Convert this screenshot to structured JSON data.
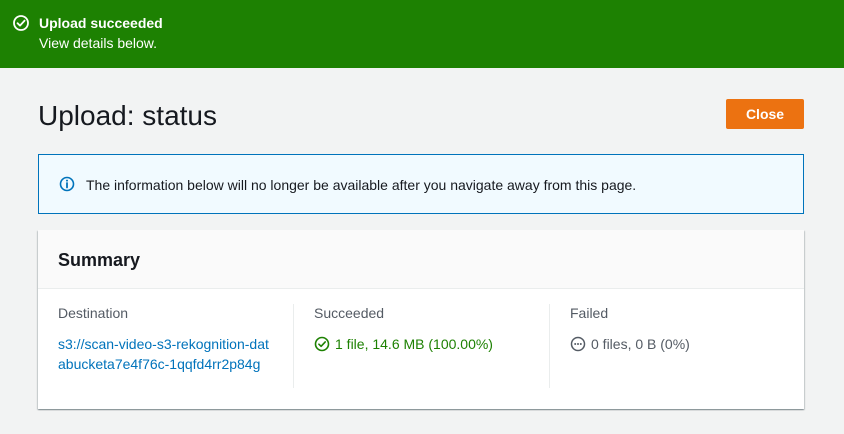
{
  "banner": {
    "title": "Upload succeeded",
    "subtitle": "View details below.",
    "icon": "check-circle-icon",
    "color": "#1d8102"
  },
  "page": {
    "title": "Upload: status",
    "close_label": "Close",
    "accent": "#ec7211"
  },
  "info": {
    "icon": "info-icon",
    "text": "The information below will no longer be available after you navigate away from this page."
  },
  "summary": {
    "heading": "Summary",
    "destination": {
      "label": "Destination",
      "value": "s3://scan-video-s3-rekognition-databucketa7e4f76c-1qqfd4rr2p84g"
    },
    "succeeded": {
      "label": "Succeeded",
      "value": "1 file, 14.6 MB (100.00%)",
      "icon": "check-circle-icon"
    },
    "failed": {
      "label": "Failed",
      "value": "0 files, 0 B (0%)",
      "icon": "ellipsis-circle-icon"
    }
  }
}
